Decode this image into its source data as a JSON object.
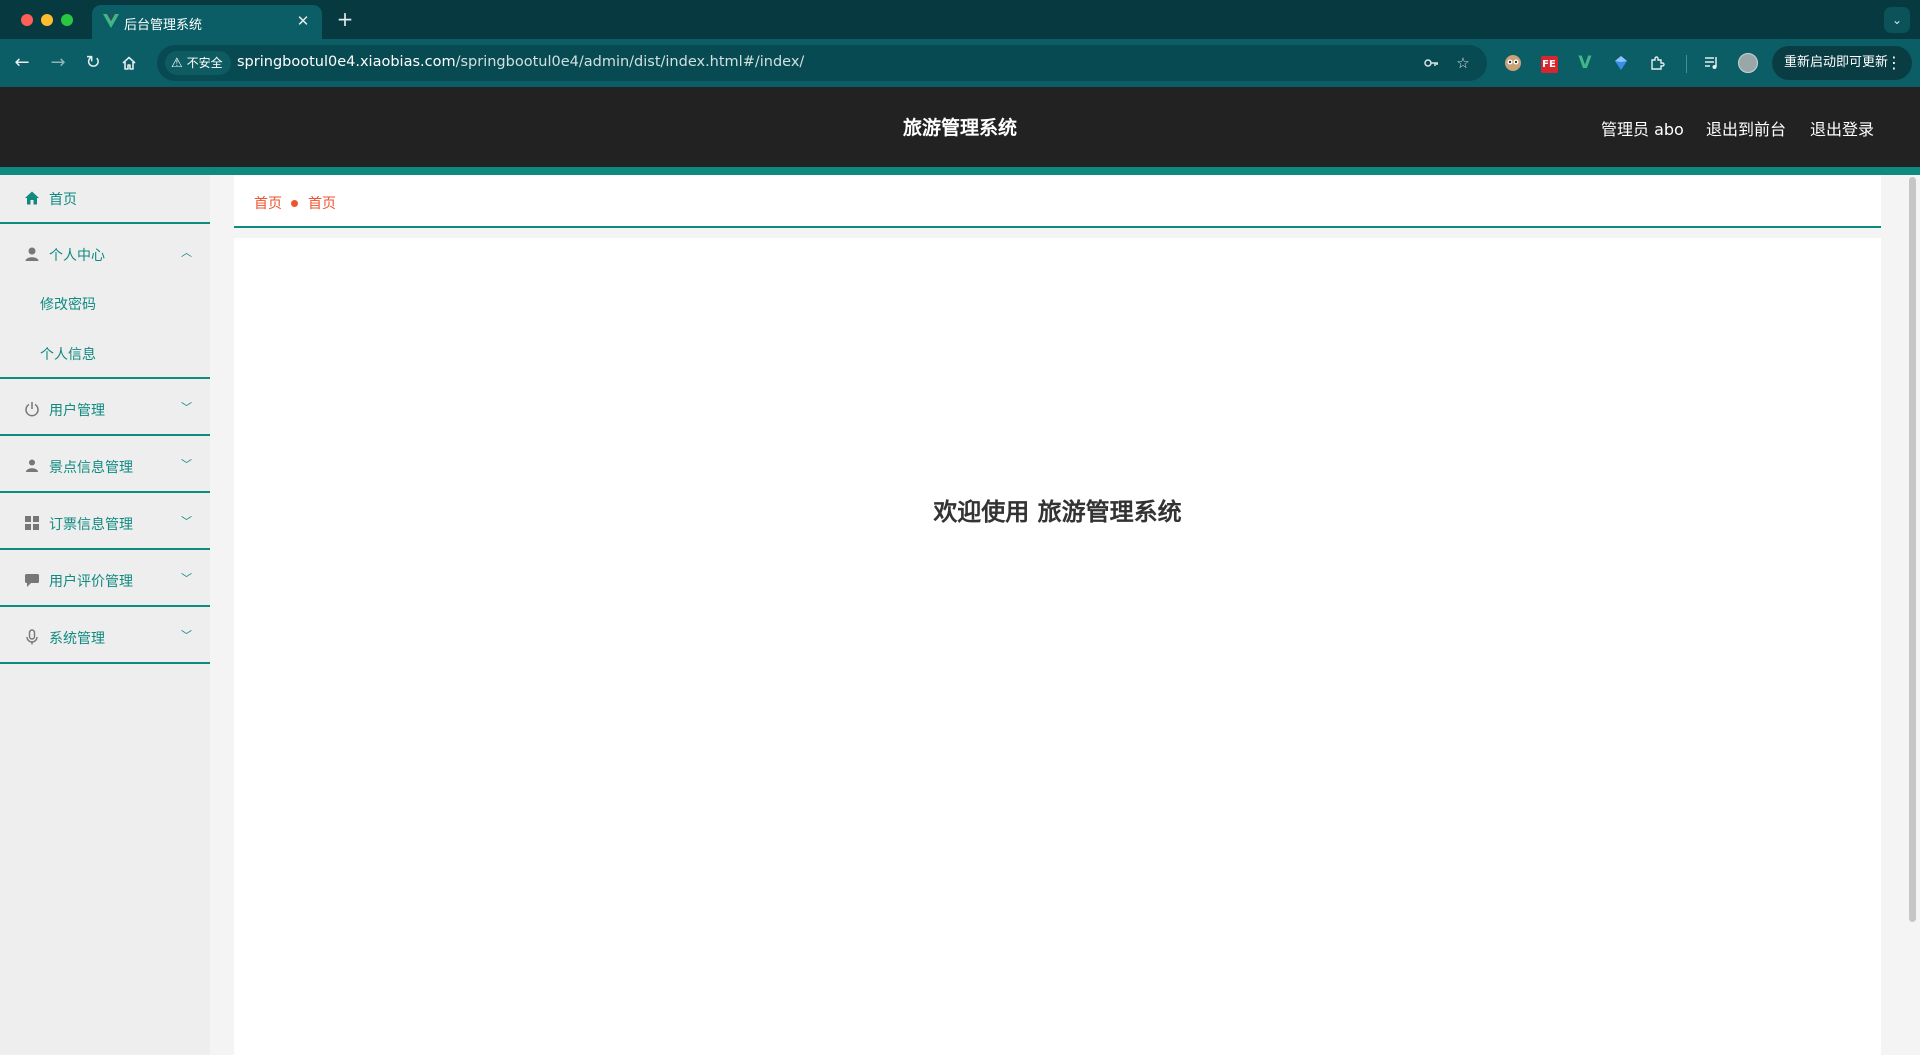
{
  "browser": {
    "tab_title": "后台管理系统",
    "tab_close": "✕",
    "new_tab": "+",
    "security_label": "不安全",
    "url_host": "springbootul0e4.xiaobias.com",
    "url_path": "/springbootul0e4/admin/dist/index.html#/index/",
    "update_button": "重新启动即可更新",
    "ext_fe_label": "FE",
    "ext_v_label": "V"
  },
  "header": {
    "title": "旅游管理系统",
    "user_label": "管理员 abo",
    "to_frontend": "退出到前台",
    "logout": "退出登录"
  },
  "sidebar": {
    "items": [
      {
        "label": "首页",
        "icon": "home-icon"
      },
      {
        "label": "个人中心",
        "icon": "user-icon",
        "expanded": true,
        "children": [
          {
            "label": "修改密码"
          },
          {
            "label": "个人信息"
          }
        ]
      },
      {
        "label": "用户管理",
        "icon": "power-icon"
      },
      {
        "label": "景点信息管理",
        "icon": "person-icon"
      },
      {
        "label": "订票信息管理",
        "icon": "grid-icon"
      },
      {
        "label": "用户评价管理",
        "icon": "chat-icon"
      },
      {
        "label": "系统管理",
        "icon": "mic-icon"
      }
    ]
  },
  "breadcrumb": {
    "items": [
      "首页",
      "首页"
    ]
  },
  "main": {
    "welcome": "欢迎使用 旅游管理系统"
  },
  "colors": {
    "accent": "#0f8a80",
    "header_bg": "#222222",
    "breadcrumb": "#f0522d",
    "sidebar_bg": "#eeeeee"
  }
}
